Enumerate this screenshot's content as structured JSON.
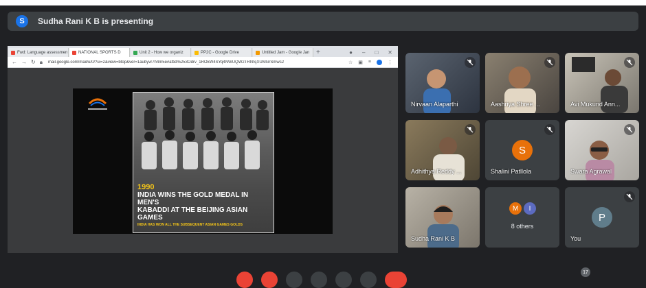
{
  "presenter": {
    "avatar_initial": "S",
    "banner": "Sudha Rani K B is presenting"
  },
  "browser": {
    "tabs": [
      {
        "label": "Fwd: Language assessmen",
        "favicon_color": "#ea4335",
        "active": false
      },
      {
        "label": "NATIONAL SPORTS D",
        "favicon_color": "#ea4335",
        "active": true
      },
      {
        "label": "Unit 2 - How we organiz",
        "favicon_color": "#34a853",
        "active": false
      },
      {
        "label": "PP2C - Google Drive",
        "favicon_color": "#fbbc04",
        "active": false
      },
      {
        "label": "Untitled Jam - Google Jan",
        "favicon_color": "#f29900",
        "active": false
      }
    ],
    "url": "mail.google.com/mail/u/0/?ui=2&view=btop&ver=1aubyvr7h4m5e#attid%253Odrv_1ROkW4SYq4NWUQW2TRNSjXUMGrSmws2"
  },
  "slide": {
    "year": "1990",
    "headline_line1": "INDIA WINS THE GOLD MEDAL IN MEN'S",
    "headline_line2": "KABADDI AT THE BEIJING ASIAN GAMES",
    "subline": "INDIA HAS WON ALL THE SUBSEQUENT ASIAN GAMES GOLDS"
  },
  "participants": [
    {
      "name": "Nirvaan Alaparthi",
      "muted": true,
      "video": true
    },
    {
      "name": "Aashriya Shree ...",
      "muted": true,
      "video": true
    },
    {
      "name": "Avi Mukund Ann...",
      "muted": true,
      "video": true
    },
    {
      "name": "Adhithya Reddy ...",
      "muted": true,
      "video": true
    },
    {
      "name": "Shalini Patllola",
      "muted": true,
      "video": false,
      "initial": "S",
      "avatar_color": "#e8710a"
    },
    {
      "name": "Swara Agrawal",
      "muted": true,
      "video": true
    },
    {
      "name": "Sudha Rani K B",
      "muted": false,
      "video": true
    },
    {
      "name": "8 others",
      "muted": false,
      "video": false,
      "initials": [
        "M",
        "I"
      ],
      "avatar_colors": [
        "#e8710a",
        "#5c6bc0"
      ]
    },
    {
      "name": "You",
      "muted": true,
      "video": false,
      "initial": "P",
      "avatar_color": "#607d8b"
    }
  ],
  "participant_count_badge": "17",
  "colors": {
    "background": "#202124",
    "tile": "#3c4043",
    "banner": "#3c4043",
    "accent": "#1a73e8"
  }
}
